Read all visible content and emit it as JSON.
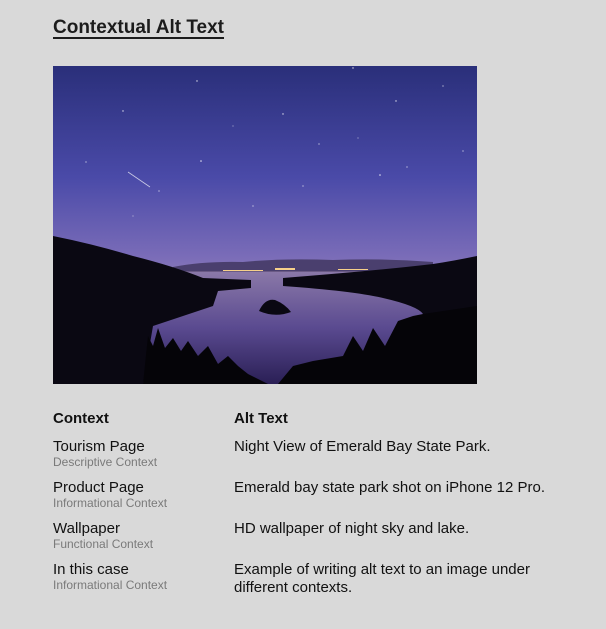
{
  "page": {
    "title": "Contextual Alt Text"
  },
  "image": {
    "subject": "night sky over Emerald Bay State Park lake with island, stars and distant city lights"
  },
  "table": {
    "headers": {
      "context": "Context",
      "alt_text": "Alt Text"
    },
    "rows": [
      {
        "context": "Tourism Page",
        "context_type": "Descriptive Context",
        "alt_text": "Night View of Emerald Bay State Park."
      },
      {
        "context": "Product Page",
        "context_type": "Informational Context",
        "alt_text": "Emerald bay state park shot on iPhone 12 Pro."
      },
      {
        "context": "Wallpaper",
        "context_type": "Functional Context",
        "alt_text": "HD wallpaper of night sky and lake."
      },
      {
        "context": "In this case",
        "context_type": "Informational Context",
        "alt_text": "Example of writing alt text to an image under different contexts."
      }
    ]
  }
}
